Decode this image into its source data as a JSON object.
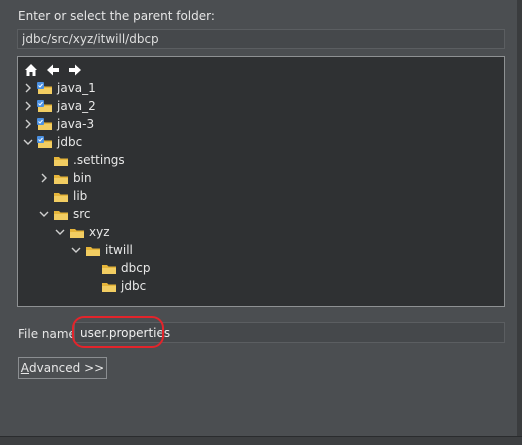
{
  "prompt_label": "Enter or select the parent folder:",
  "parent_folder_value": "jdbc/src/xyz/itwill/dbcp",
  "tree_nav": {
    "icons": [
      "home-icon",
      "back-arrow-icon",
      "forward-arrow-icon"
    ]
  },
  "tree": [
    {
      "label": "java_1",
      "type": "project",
      "expander": "collapsed"
    },
    {
      "label": "java_2",
      "type": "project",
      "expander": "collapsed"
    },
    {
      "label": "java-3",
      "type": "project",
      "expander": "collapsed"
    },
    {
      "label": "jdbc",
      "type": "project",
      "expander": "expanded"
    },
    {
      "label": ".settings",
      "type": "folder",
      "expander": "none"
    },
    {
      "label": "bin",
      "type": "folder",
      "expander": "collapsed"
    },
    {
      "label": "lib",
      "type": "folder",
      "expander": "none"
    },
    {
      "label": "src",
      "type": "folder",
      "expander": "expanded"
    },
    {
      "label": "xyz",
      "type": "folder",
      "expander": "expanded"
    },
    {
      "label": "itwill",
      "type": "folder",
      "expander": "expanded"
    },
    {
      "label": "dbcp",
      "type": "folder",
      "expander": "none"
    },
    {
      "label": "jdbc",
      "type": "folder",
      "expander": "none"
    }
  ],
  "file_name_label": "File name:",
  "file_name_value": "user.properties",
  "advanced_button": {
    "mnemonic": "A",
    "rest": "dvanced >>"
  },
  "colors": {
    "folder": "#e6b53a",
    "project_folder": "#4a90e2",
    "highlight_ring": "#e3242b"
  }
}
